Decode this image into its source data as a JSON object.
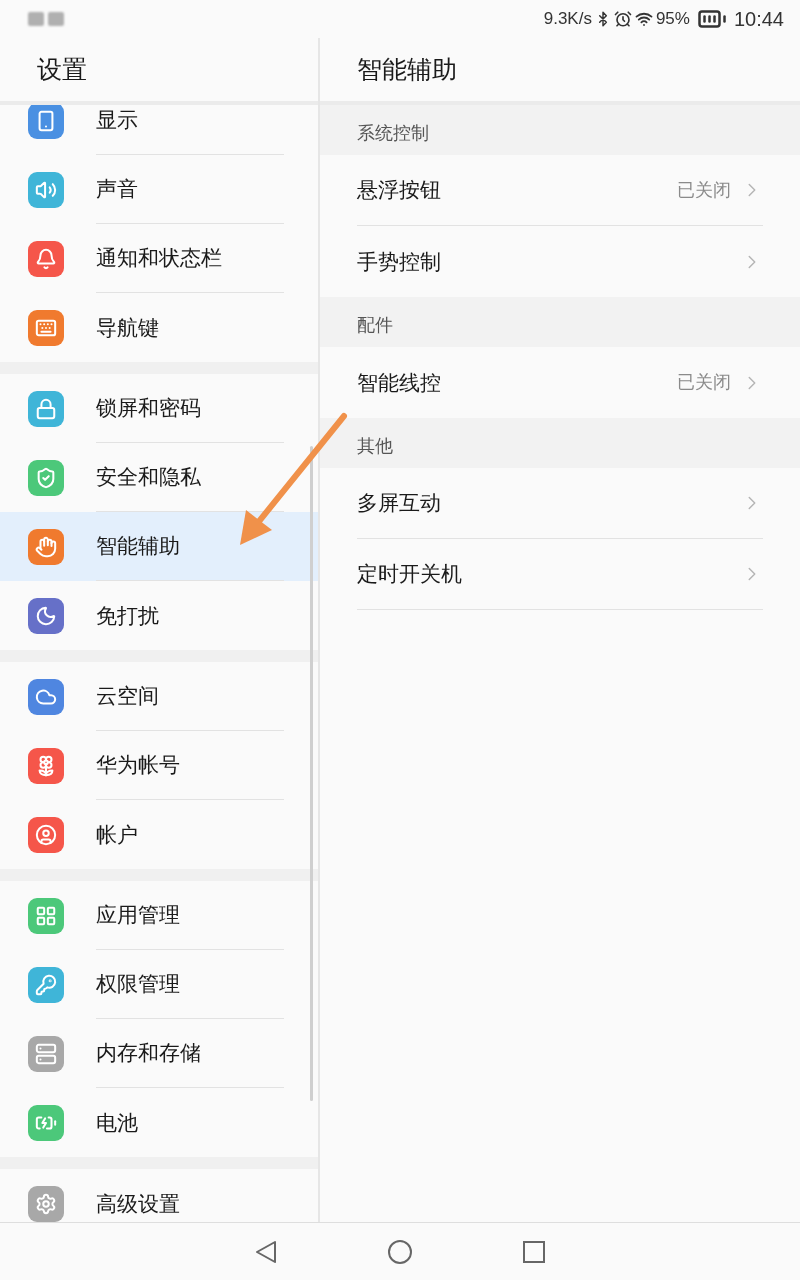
{
  "status_bar": {
    "network_speed": "9.3K/s",
    "battery_percent": "95%",
    "time": "10:44"
  },
  "sidebar": {
    "title": "设置",
    "groups": [
      {
        "items": [
          {
            "label": "显示",
            "color": "#4a90e2",
            "selected": false
          },
          {
            "label": "声音",
            "color": "#3fb5d8",
            "selected": false
          },
          {
            "label": "通知和状态栏",
            "color": "#f5564a",
            "selected": false
          },
          {
            "label": "导航键",
            "color": "#f07a2e",
            "selected": false
          }
        ]
      },
      {
        "items": [
          {
            "label": "锁屏和密码",
            "color": "#3fb5d8",
            "selected": false
          },
          {
            "label": "安全和隐私",
            "color": "#4cc87a",
            "selected": false
          },
          {
            "label": "智能辅助",
            "color": "#f07a2e",
            "selected": true
          },
          {
            "label": "免打扰",
            "color": "#6670c8",
            "selected": false
          }
        ]
      },
      {
        "items": [
          {
            "label": "云空间",
            "color": "#4f86e0",
            "selected": false
          },
          {
            "label": "华为帐号",
            "color": "#f5564a",
            "selected": false
          },
          {
            "label": "帐户",
            "color": "#f5564a",
            "selected": false
          }
        ]
      },
      {
        "items": [
          {
            "label": "应用管理",
            "color": "#4cc87a",
            "selected": false
          },
          {
            "label": "权限管理",
            "color": "#3fb5d8",
            "selected": false
          },
          {
            "label": "内存和存储",
            "color": "#a8a8a8",
            "selected": false
          },
          {
            "label": "电池",
            "color": "#4cc87a",
            "selected": false
          }
        ]
      },
      {
        "items": [
          {
            "label": "高级设置",
            "color": "#a8a8a8",
            "selected": false
          }
        ]
      }
    ]
  },
  "detail": {
    "title": "智能辅助",
    "sections": [
      {
        "header": "系统控制",
        "rows": [
          {
            "label": "悬浮按钮",
            "value": "已关闭"
          },
          {
            "label": "手势控制"
          }
        ]
      },
      {
        "header": "配件",
        "rows": [
          {
            "label": "智能线控",
            "value": "已关闭"
          }
        ]
      },
      {
        "header": "其他",
        "rows": [
          {
            "label": "多屏互动"
          },
          {
            "label": "定时开关机"
          }
        ]
      }
    ]
  }
}
